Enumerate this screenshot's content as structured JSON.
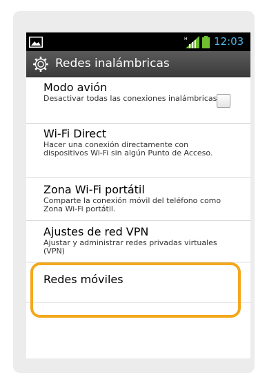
{
  "statusbar": {
    "time": "12:03",
    "icons": {
      "notification": "gallery-icon",
      "signal": "signal-icon",
      "battery": "battery-icon"
    },
    "time_color": "#4fb8e8"
  },
  "titlebar": {
    "title": "Redes inalámbricas",
    "icon": "gear-icon"
  },
  "items": [
    {
      "title": "Modo avión",
      "description": "Desactivar todas las conexiones inalámbricas",
      "has_checkbox": true,
      "checked": false
    },
    {
      "title": "Wi-Fi Direct",
      "description": "Hacer una conexión directamente con dispositivos Wi-Fi sin algún Punto de Acceso."
    },
    {
      "title": "Zona Wi-Fi portátil",
      "description": "Comparte la conexión móvil del teléfono como Zona Wi-Fi portátil."
    },
    {
      "title": "Ajustes de red VPN",
      "description": "Ajustar y administrar redes privadas virtuales (VPN)"
    },
    {
      "title": "Redes móviles",
      "description": ""
    }
  ],
  "highlight_color": "#f3a81b"
}
